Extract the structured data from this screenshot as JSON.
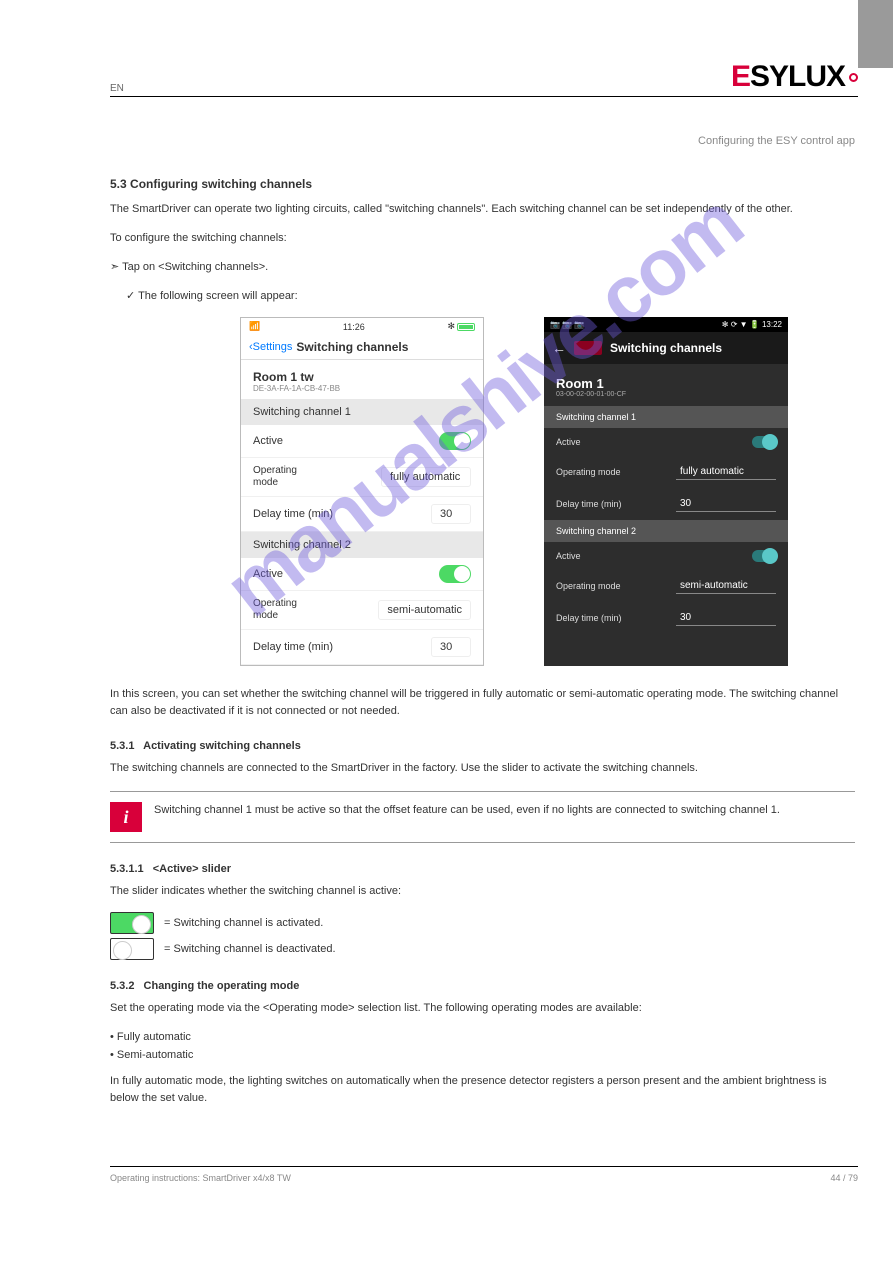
{
  "header": {
    "left": "EN",
    "logo_part1": "E",
    "logo_part2": "SYLUX"
  },
  "subtitle": "Configuring the ESY control app",
  "section_main": {
    "num": "5.3",
    "title": "Configuring switching channels"
  },
  "intro": "The SmartDriver can operate two lighting circuits, called \"switching channels\". Each switching channel can be set independently of the other.",
  "steps_intro": "To configure the switching channels:",
  "step1": "➣ Tap on <Switching channels>.",
  "step1_result": "✓ The following screen will appear:",
  "ios": {
    "time": "11:26",
    "bt": "✻",
    "back": "Settings",
    "title": "Switching channels",
    "room": "Room 1 tw",
    "room_id": "DE-3A-FA-1A-CB-47-BB",
    "ch1": {
      "header": "Switching channel 1",
      "active": "Active",
      "opmode_label": "Operating\nmode",
      "opmode_value": "fully automatic",
      "delay_label": "Delay time (min)",
      "delay_value": "30"
    },
    "ch2": {
      "header": "Switching channel 2",
      "active": "Active",
      "opmode_label": "Operating\nmode",
      "opmode_value": "semi-automatic",
      "delay_label": "Delay time (min)",
      "delay_value": "30"
    }
  },
  "android": {
    "statusbar_left": "📷 📷 📷",
    "statusbar_right": "✻ ⟳ ▼  🔋 13:22",
    "title": "Switching channels",
    "room": "Room 1",
    "room_id": "03-00-02-00-01-00-CF",
    "ch1": {
      "header": "Switching channel 1",
      "active": "Active",
      "opmode_label": "Operating mode",
      "opmode_value": "fully automatic",
      "delay_label": "Delay time (min)",
      "delay_value": "30"
    },
    "ch2": {
      "header": "Switching channel 2",
      "active": "Active",
      "opmode_label": "Operating mode",
      "opmode_value": "semi-automatic",
      "delay_label": "Delay time (min)",
      "delay_value": "30"
    }
  },
  "explain1": "In this screen, you can set whether the switching channel will be triggered in fully automatic or semi-automatic operating mode. The switching channel can also be deactivated if it is not connected or not needed.",
  "sub1": {
    "num": "5.3.1",
    "title": "Activating switching channels"
  },
  "sub1_text": "The switching channels are connected to the SmartDriver in the factory. Use the slider to activate the switching channels.",
  "info_text": "Switching channel 1 must be active so that the offset feature can be used, even if no lights are connected to switching channel 1.",
  "sub2": {
    "num": "5.3.1.1",
    "title": "<Active> slider"
  },
  "sub2_intro": "The slider indicates whether the switching channel is active:",
  "toggle_on_text": " = Switching channel is activated.",
  "toggle_off_text": " = Switching channel is deactivated.",
  "sub3": {
    "num": "5.3.2",
    "title": "Changing the operating mode"
  },
  "sub3_intro": "Set the operating mode via the <Operating mode> selection list. The following operating modes are available:",
  "bullets": [
    "Fully automatic",
    "Semi-automatic"
  ],
  "sub3_text2": "In fully automatic mode, the lighting switches on automatically when the presence detector registers a person present and the ambient brightness is below the set value.",
  "footer": {
    "left": "Operating instructions: SmartDriver x4/x8 TW",
    "right": "44 / 79"
  },
  "watermark": "manualshive.com"
}
